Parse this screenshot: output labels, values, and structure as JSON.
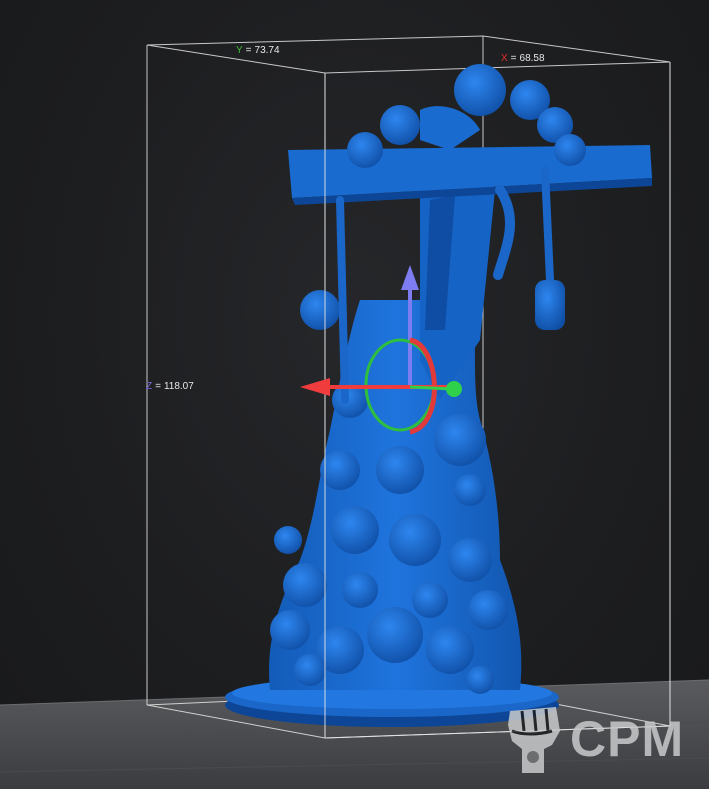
{
  "viewport": {
    "background": "#1e1f21",
    "model_color": "#1f6ed4",
    "bbox_color": "#e6e6e6"
  },
  "dimensions": {
    "y": {
      "axis": "Y",
      "value": "73.74",
      "color": "#3fbf3f"
    },
    "x": {
      "axis": "X",
      "value": "68.58",
      "color": "#e03030"
    },
    "z": {
      "axis": "Z",
      "value": "118.07",
      "color": "#7a6ae0"
    }
  },
  "gizmo": {
    "x_arrow_color": "#f03c3c",
    "y_handle_color": "#2fd14a",
    "z_arrow_color": "#7d7cf0",
    "rotate_ring_x_color": "#e23a3a",
    "rotate_ring_y_color": "#2fbf3f"
  },
  "watermark": {
    "text": "CPM",
    "icon": "raised-fist-icon"
  }
}
